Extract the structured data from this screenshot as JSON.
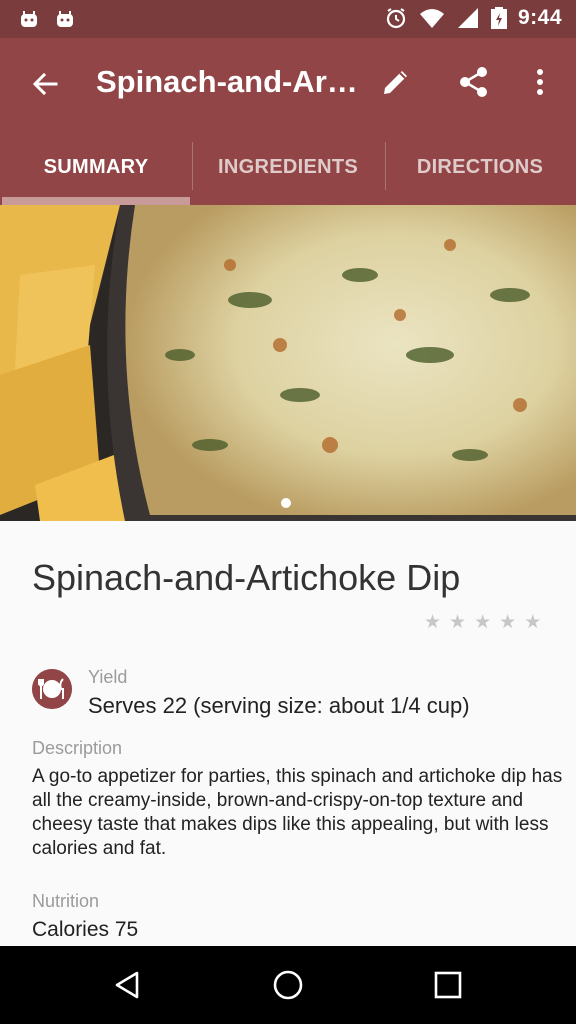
{
  "status_bar": {
    "time": "9:44",
    "left_icons": [
      "android-icon",
      "android-icon"
    ],
    "right_icons": [
      "alarm-icon",
      "wifi-icon",
      "signal-icon",
      "battery-icon"
    ]
  },
  "app_bar": {
    "title": "Spinach-and-Artichoke Dip",
    "actions": [
      "back-icon",
      "edit-icon",
      "share-icon",
      "more-vert-icon"
    ]
  },
  "tabs": [
    {
      "label": "SUMMARY",
      "active": true
    },
    {
      "label": "INGREDIENTS",
      "active": false
    },
    {
      "label": "DIRECTIONS",
      "active": false
    }
  ],
  "hero": {
    "pager_pages": 1,
    "current_page": 1
  },
  "recipe": {
    "name": "Spinach-and-Artichoke Dip",
    "rating_stars": 5,
    "rating_value": 0,
    "yield_label": "Yield",
    "yield_value": "Serves 22 (serving size: about 1/4 cup)",
    "description_label": "Description",
    "description": "A go-to appetizer for parties, this spinach and artichoke dip has all the creamy-inside, brown-and-crispy-on-top texture and cheesy taste that makes dips like this appealing, but with less calories and fat.",
    "nutrition_label": "Nutrition",
    "calories": "Calories 75"
  },
  "colors": {
    "status_bar": "#7b3c3d",
    "app_bar": "#914546",
    "tab_indicator": "#c99a9a"
  }
}
